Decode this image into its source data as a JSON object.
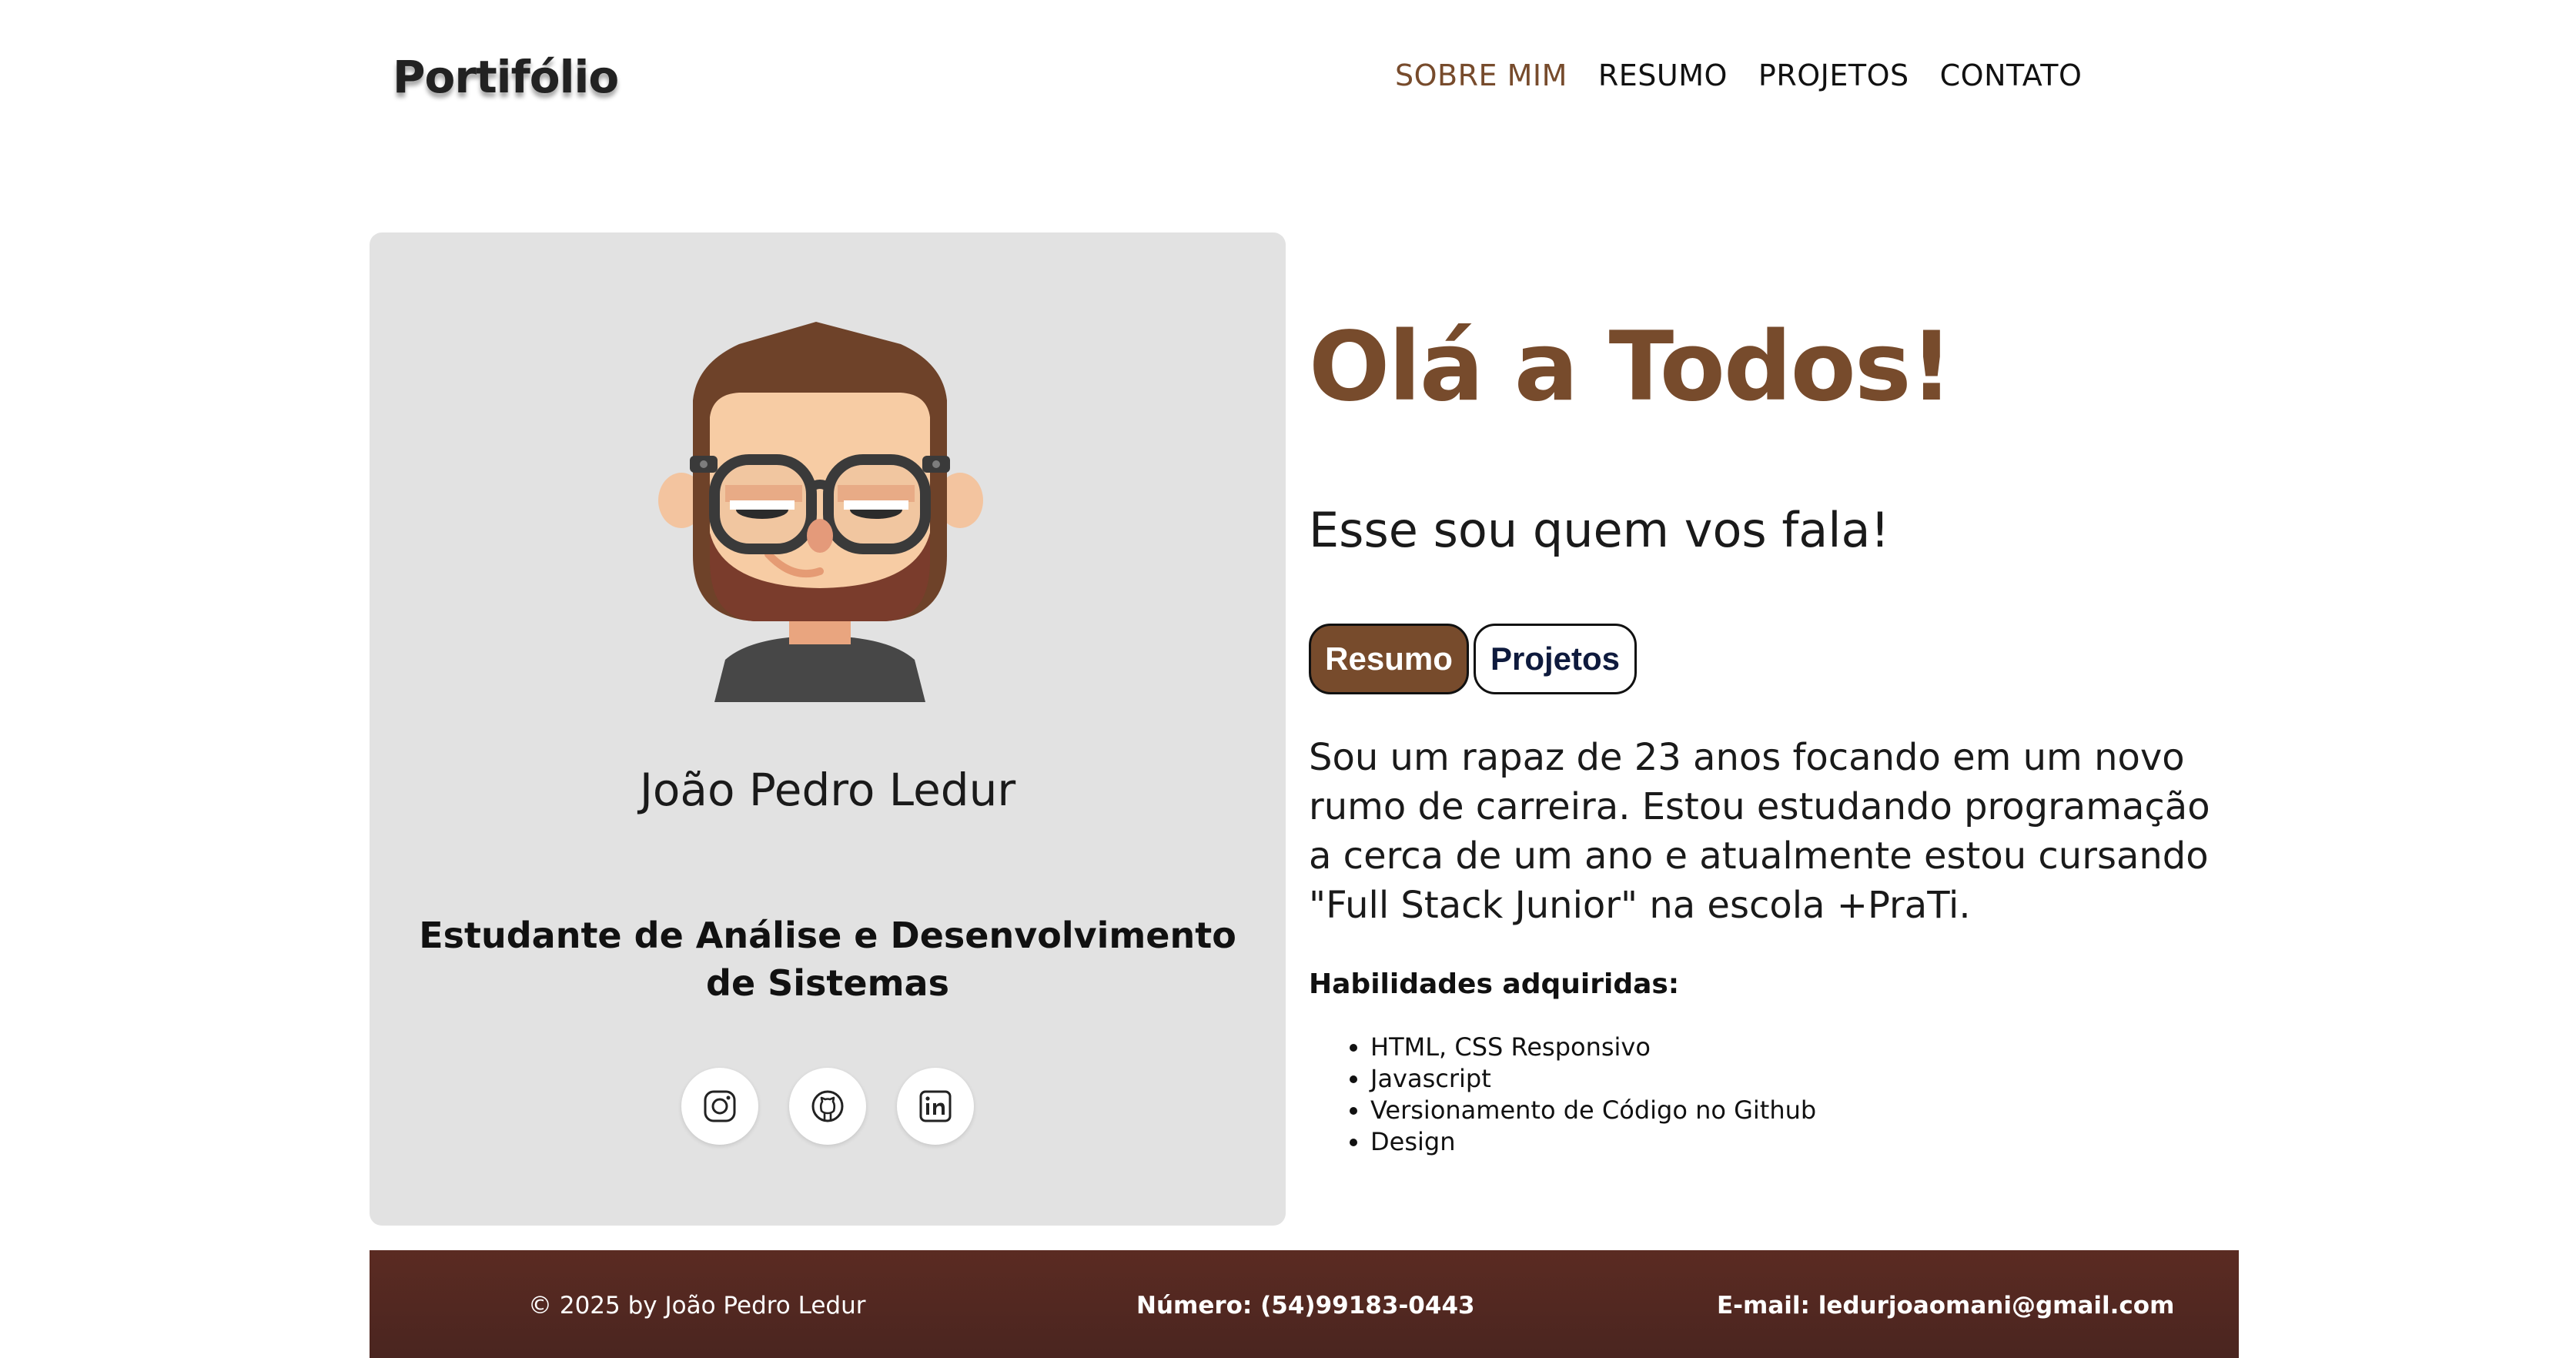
{
  "header": {
    "logo": "Portifólio",
    "nav": [
      {
        "label": "SOBRE MIM",
        "active": true
      },
      {
        "label": "RESUMO",
        "active": false
      },
      {
        "label": "PROJETOS",
        "active": false
      },
      {
        "label": "CONTATO",
        "active": false
      }
    ]
  },
  "profile": {
    "name": "João Pedro Ledur",
    "role": "Estudante de Análise e Desenvolvimento de Sistemas",
    "avatar_icon": "cartoon-avatar-with-glasses",
    "socials": [
      {
        "icon": "instagram-icon"
      },
      {
        "icon": "github-icon"
      },
      {
        "icon": "linkedin-icon"
      }
    ]
  },
  "main": {
    "greeting": "Olá a Todos!",
    "subtitle": "Esse sou quem vos fala!",
    "buttons": {
      "resumo": "Resumo",
      "projetos": "Projetos"
    },
    "bio": "Sou um rapaz de 23 anos focando em um novo rumo de carreira. Estou estudando programação a cerca de um ano e atualmente estou cursando \"Full Stack Junior\" na escola +PraTi.",
    "skills_title": "Habilidades adquiridas:",
    "skills": [
      "HTML, CSS Responsivo",
      "Javascript",
      "Versionamento de Código no Github",
      "Design"
    ]
  },
  "footer": {
    "copyright": "© 2025 by João Pedro Ledur",
    "phone": "Número: (54)99183-0443",
    "email": "E-mail: ledurjoaomani@gmail.com"
  },
  "colors": {
    "accent": "#774b2c",
    "card_bg": "#e2e2e2",
    "footer_bg": "#5b2b22"
  }
}
